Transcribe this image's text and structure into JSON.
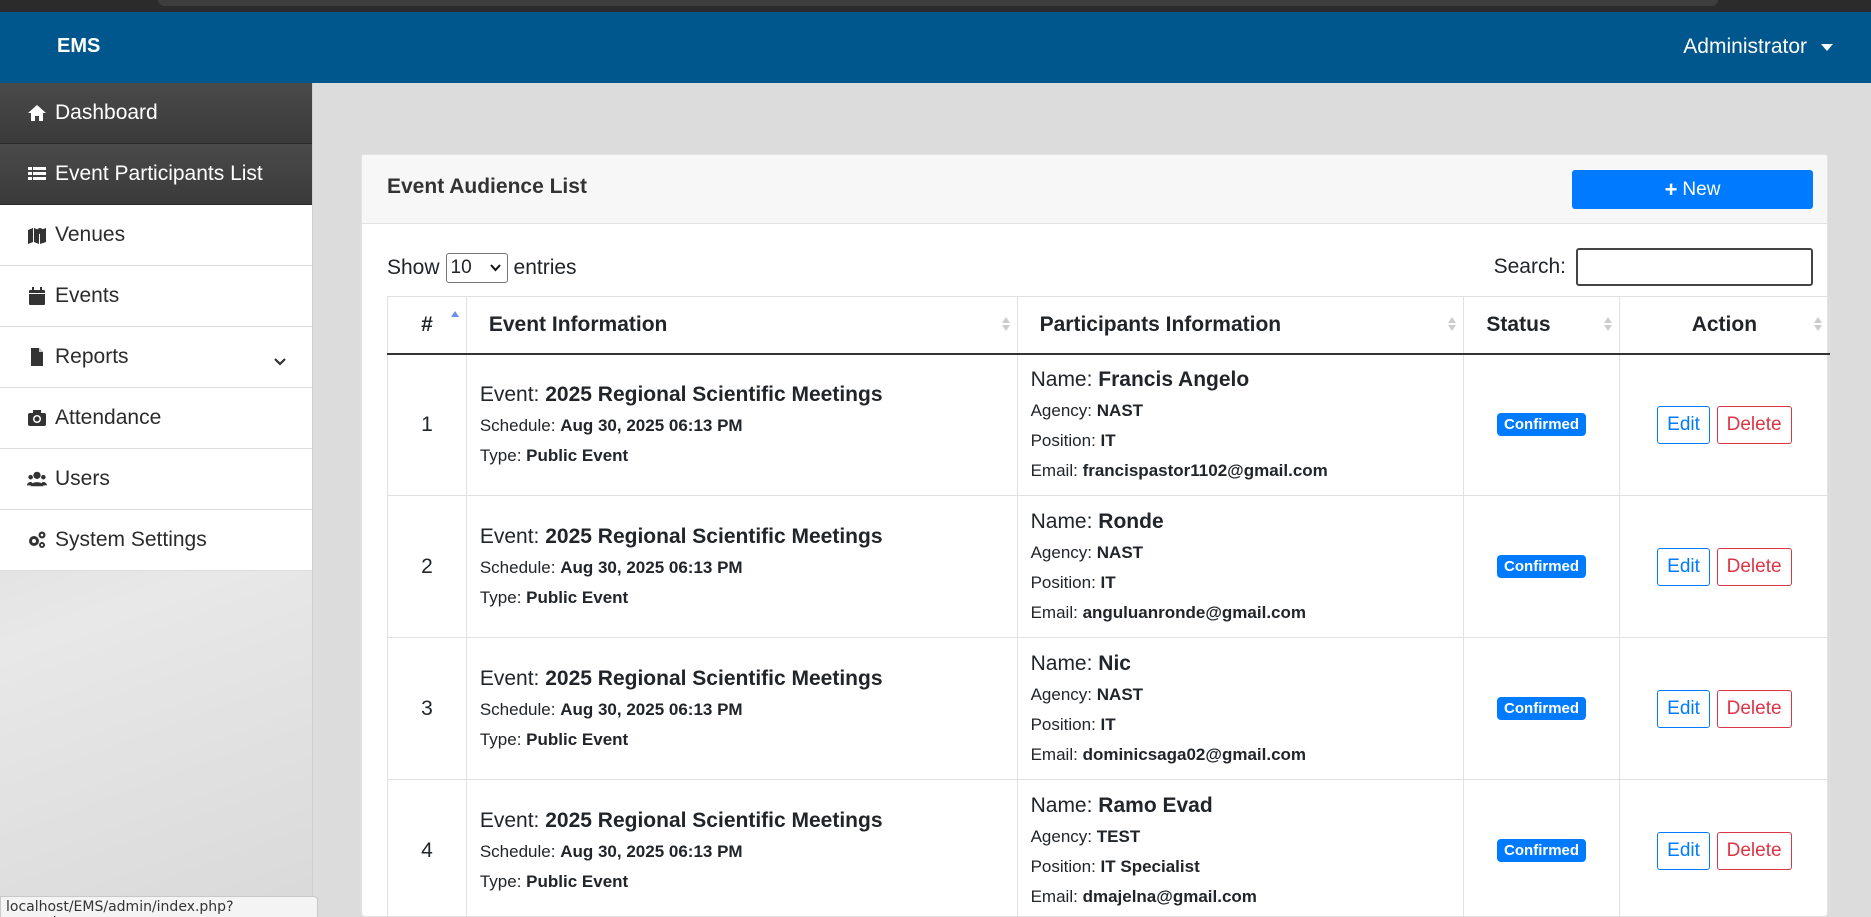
{
  "navbar": {
    "brand": "EMS",
    "user": "Administrator"
  },
  "sidebar": {
    "items": [
      {
        "label": "Dashboard",
        "icon": "home-icon",
        "active": true
      },
      {
        "label": "Event Participants List",
        "icon": "list-icon",
        "active": true
      },
      {
        "label": "Venues",
        "icon": "map-icon",
        "active": false
      },
      {
        "label": "Events",
        "icon": "calendar-icon",
        "active": false
      },
      {
        "label": "Reports",
        "icon": "file-icon",
        "active": false,
        "has_submenu": true
      },
      {
        "label": "Attendance",
        "icon": "camera-icon",
        "active": false
      },
      {
        "label": "Users",
        "icon": "users-icon",
        "active": false
      },
      {
        "label": "System Settings",
        "icon": "cogs-icon",
        "active": false
      }
    ]
  },
  "status_url": "localhost/EMS/admin/index.php?page=home",
  "card": {
    "title": "Event Audience List",
    "new_button": "New",
    "show_label": "Show",
    "entries_label": "entries",
    "length_value": "10",
    "search_label": "Search:",
    "search_value": ""
  },
  "table": {
    "headers": [
      "#",
      "Event Information",
      "Participants Information",
      "Status",
      "Action"
    ],
    "labels": {
      "event": "Event:",
      "schedule": "Schedule:",
      "type": "Type:",
      "name": "Name:",
      "agency": "Agency:",
      "position": "Position:",
      "email": "Email:"
    },
    "edit_label": "Edit",
    "delete_label": "Delete",
    "rows": [
      {
        "num": "1",
        "event": "2025 Regional Scientific Meetings",
        "schedule": "Aug 30, 2025 06:13 PM",
        "type": "Public Event",
        "name": "Francis Angelo",
        "agency": "NAST",
        "position": "IT",
        "email": "francispastor1102@gmail.com",
        "status": "Confirmed"
      },
      {
        "num": "2",
        "event": "2025 Regional Scientific Meetings",
        "schedule": "Aug 30, 2025 06:13 PM",
        "type": "Public Event",
        "name": "Ronde",
        "agency": "NAST",
        "position": "IT",
        "email": "anguluanronde@gmail.com",
        "status": "Confirmed"
      },
      {
        "num": "3",
        "event": "2025 Regional Scientific Meetings",
        "schedule": "Aug 30, 2025 06:13 PM",
        "type": "Public Event",
        "name": "Nic",
        "agency": "NAST",
        "position": "IT",
        "email": "dominicsaga02@gmail.com",
        "status": "Confirmed"
      },
      {
        "num": "4",
        "event": "2025 Regional Scientific Meetings",
        "schedule": "Aug 30, 2025 06:13 PM",
        "type": "Public Event",
        "name": "Ramo Evad",
        "agency": "TEST",
        "position": "IT Specialist",
        "email": "dmajelna@gmail.com",
        "status": "Confirmed"
      }
    ]
  },
  "colors": {
    "navbar": "#00578e",
    "primary": "#007bff",
    "danger": "#dc3545",
    "sidebar_active": "#3f3f3f"
  }
}
